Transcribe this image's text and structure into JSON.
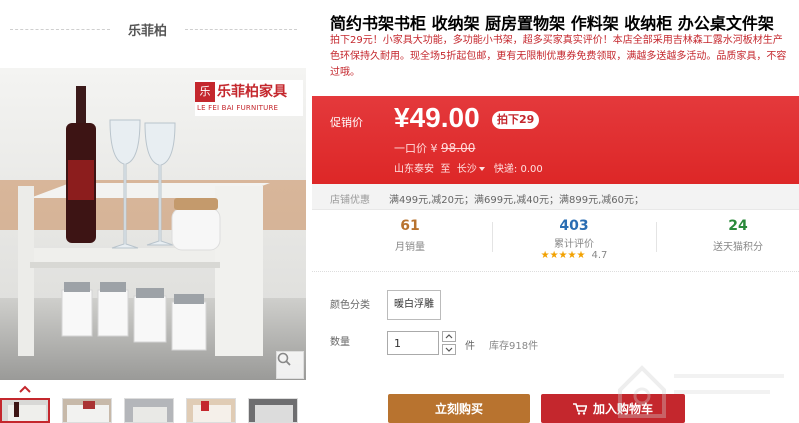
{
  "store": {
    "brand_name": "乐菲柏"
  },
  "gallery": {
    "logo_cn": "乐菲柏家具",
    "logo_en": "LE FEI BAI FURNITURE",
    "logo_mark": "乐",
    "thumb_count": 5
  },
  "product": {
    "title": "简约书架书柜 收纳架 厨房置物架 作料架 收纳柜 办公桌文件架",
    "desc_lines": [
      "拍下29元！小家具大功能，多功能小书架，超多买家真实评价！本店全部采用吉林森工露水河板材生产",
      "色环保持久耐用。现全场5折起包邮，更有无限制优惠券免费领取，满越多送越多活动。品质家具，不容",
      "过哦。"
    ]
  },
  "price": {
    "label": "促销价",
    "value": "¥49.00",
    "discount_tag": "拍下29",
    "orig_prefix": "一口价 ¥",
    "orig_value": "98.00",
    "ship_from": "山东泰安",
    "ship_to_word": "至",
    "ship_dest": "长沙",
    "ship_cost": "快递: 0.00"
  },
  "promo": {
    "label": "店铺优惠",
    "text": "满499元,减20元；满699元,减40元；满899元,减60元；"
  },
  "stats": {
    "monthly_sales": {
      "value": "61",
      "label": "月销量",
      "color": "#b8732f"
    },
    "reviews": {
      "value": "403",
      "label": "累计评价",
      "stars": "★★★★★",
      "score": "4.7",
      "color": "#2a6db3"
    },
    "points": {
      "value": "24",
      "label": "送天猫积分",
      "color": "#2a8a3a"
    }
  },
  "options": {
    "color_label": "颜色分类",
    "color_value": "暖白浮雕",
    "qty_label": "数量",
    "qty_value": "1",
    "qty_unit": "件",
    "stock": "库存918件"
  },
  "actions": {
    "buy_now": "立刻购买",
    "add_cart": "加入购物车"
  },
  "colors": {
    "brand_red": "#c4272d",
    "price_red": "#e4393c",
    "buy_brown": "#b8732f"
  }
}
